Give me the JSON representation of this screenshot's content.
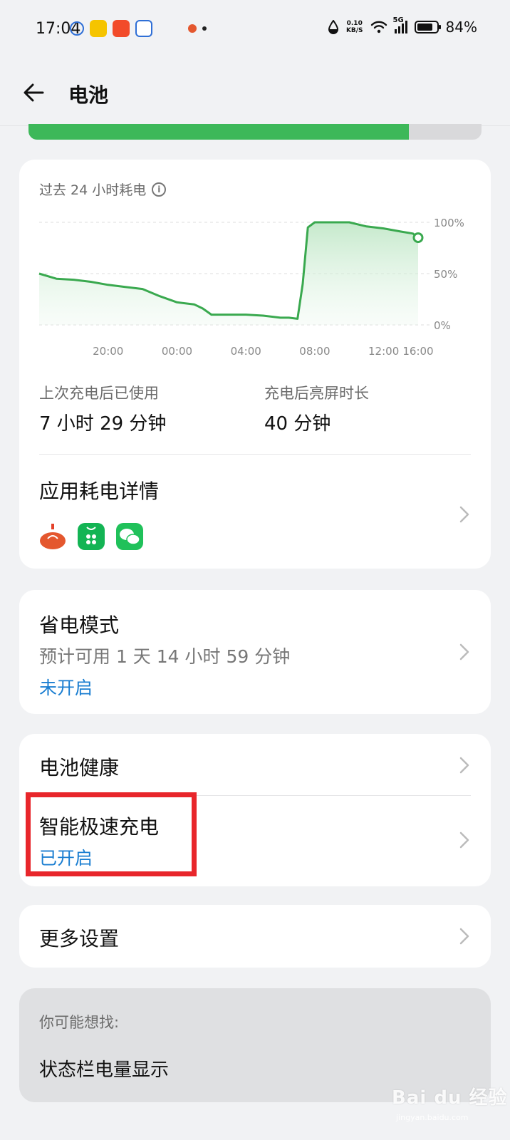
{
  "status_bar": {
    "time": "17:04",
    "net_speed_value": "0.10",
    "net_speed_unit": "KB/S",
    "network": "5G",
    "battery_percent": "84%",
    "battery_level": 0.84
  },
  "header": {
    "title": "电池"
  },
  "top_progress": {
    "fill_fraction": 0.84,
    "color": "#3db859"
  },
  "usage_chart": {
    "title": "过去 24 小时耗电",
    "info_icon": "info-icon"
  },
  "chart_data": {
    "type": "area",
    "title": "过去 24 小时耗电",
    "x_tick_labels": [
      "20:00",
      "00:00",
      "04:00",
      "08:00",
      "12:00",
      "16:00"
    ],
    "y_tick_labels": [
      "100%",
      "50%",
      "0%"
    ],
    "ylim": [
      0,
      100
    ],
    "grid": true,
    "color": "#3aa94f",
    "series": [
      {
        "x": [
          17.0,
          18.0,
          19.0,
          20.0,
          21.0,
          22.0,
          23.0,
          24.0,
          25.0,
          26.0,
          26.5,
          27.0,
          28.0,
          29.0,
          30.0,
          31.0,
          31.5,
          32.0,
          32.3,
          32.6,
          33.0,
          34.0,
          35.0,
          36.0,
          37.0,
          38.0,
          38.7,
          39.0
        ],
        "y": [
          50,
          45,
          44,
          42,
          39,
          37,
          35,
          28,
          22,
          20,
          16,
          10,
          10,
          10,
          9,
          7,
          7,
          6,
          40,
          95,
          100,
          100,
          100,
          96,
          94,
          91,
          89,
          85
        ]
      }
    ]
  },
  "stats": {
    "since_charge_label": "上次充电后已使用",
    "since_charge_value": "7 小时 29 分钟",
    "screen_on_label": "充电后亮屏时长",
    "screen_on_value": "40 分钟"
  },
  "app_usage": {
    "title": "应用耗电详情",
    "apps": [
      "tomato-app-icon",
      "green-store-app-icon",
      "wechat-app-icon"
    ]
  },
  "power_saving": {
    "title": "省电模式",
    "estimate": "预计可用 1 天 14 小时 59 分钟",
    "status": "未开启"
  },
  "battery_health": {
    "title": "电池健康"
  },
  "smart_charging": {
    "title": "智能极速充电",
    "status": "已开启",
    "highlight_color": "#e8262b"
  },
  "more_settings": {
    "title": "更多设置"
  },
  "suggestions": {
    "label": "你可能想找:",
    "item": "状态栏电量显示"
  },
  "watermark": {
    "text": "Bai du 经验",
    "sub": "jingyan.baidu.com"
  }
}
